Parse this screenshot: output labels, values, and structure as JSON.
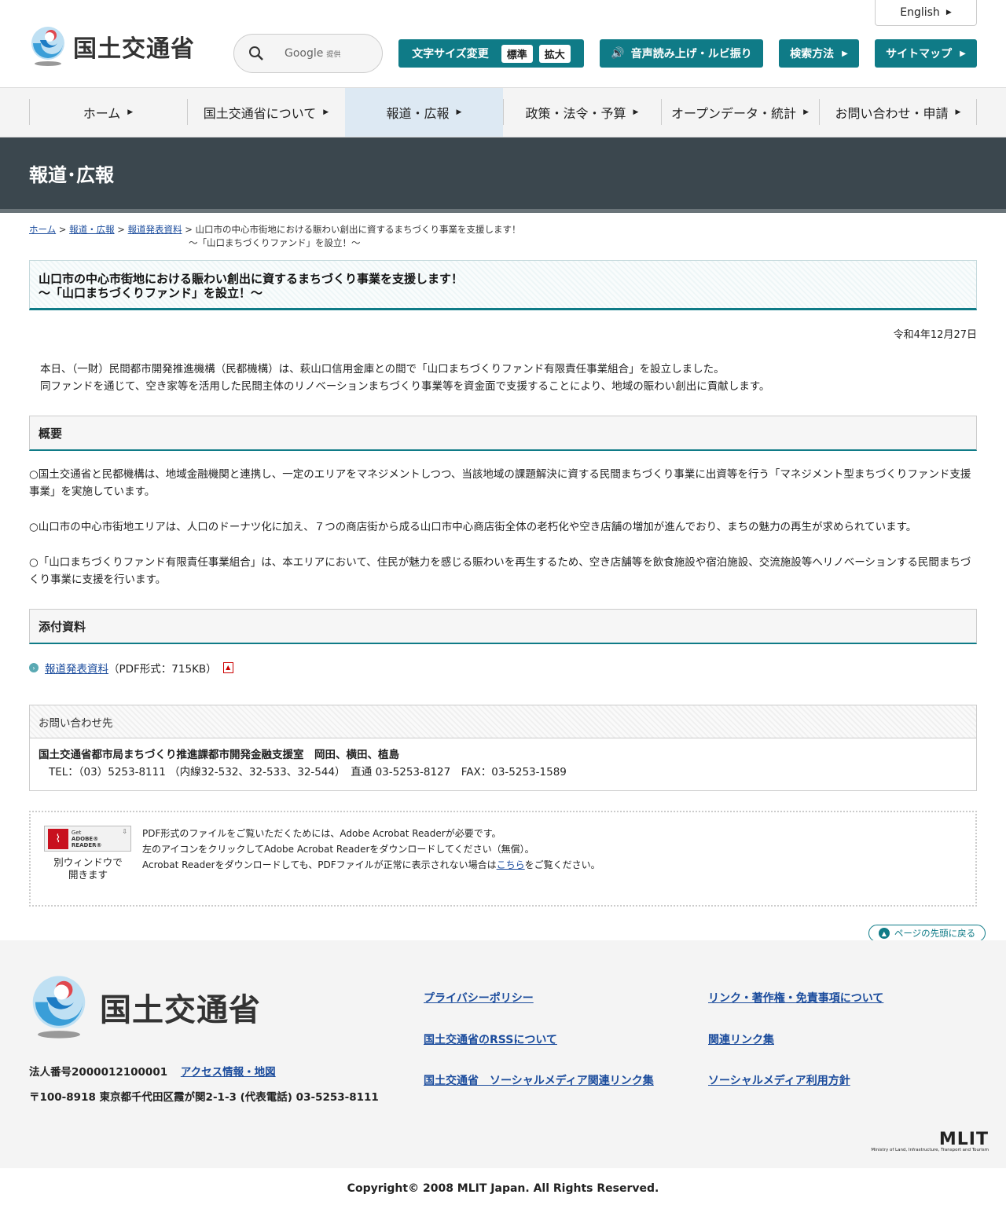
{
  "header": {
    "logo_text": "国土交通省",
    "english_label": "English",
    "search_placeholder": "Google",
    "search_provider_note": "提供",
    "font_size_label": "文字サイズ変更",
    "font_size_standard": "標準",
    "font_size_large": "拡大",
    "speech_label": "音声読み上げ・ルビ振り",
    "search_method_label": "検索方法",
    "sitemap_label": "サイトマップ"
  },
  "nav": {
    "items": [
      {
        "label": "ホーム"
      },
      {
        "label": "国土交通省について"
      },
      {
        "label": "報道・広報"
      },
      {
        "label": "政策・法令・予算"
      },
      {
        "label": "オープンデータ・統計"
      },
      {
        "label": "お問い合わせ・申請"
      }
    ]
  },
  "band_title": "報道･広報",
  "breadcrumb": {
    "home": "ホーム",
    "pr": "報道・広報",
    "releases": "報道発表資料",
    "current_line1": "山口市の中心市街地における賑わい創出に資するまちづくり事業を支援します！",
    "current_line2": "～「山口まちづくりファンド」を設立！～"
  },
  "article": {
    "title_line1": "山口市の中心市街地における賑わい創出に資するまちづくり事業を支援します！",
    "title_line2": "～「山口まちづくりファンド」を設立！～",
    "date": "令和4年12月27日",
    "lead_line1": "本日、（一財）民間都市開発推進機構（民都機構）は、萩山口信用金庫との間で「山口まちづくりファンド有限責任事業組合」を設立しました。",
    "lead_line2": "同ファンドを通じて、空き家等を活用した民間主体のリノベーションまちづくり事業等を資金面で支援することにより、地域の賑わい創出に貢献します。",
    "overview_heading": "概要",
    "overview_p1": "○国土交通省と民都機構は、地域金融機関と連携し、一定のエリアをマネジメントしつつ、当該地域の課題解決に資する民間まちづくり事業に出資等を行う「マネジメント型まちづくりファンド支援事業」を実施しています。",
    "overview_p2": "○山口市の中心市街地エリアは、人口のドーナツ化に加え、７つの商店街から成る山口市中心商店街全体の老朽化や空き店舗の増加が進んでおり、まちの魅力の再生が求められています。",
    "overview_p3": "○「山口まちづくりファンド有限責任事業組合」は、本エリアにおいて、住民が魅力を感じる賑わいを再生するため、空き店舗等を飲食施設や宿泊施設、交流施設等へリノベーションする民間まちづくり事業に支援を行います。",
    "attachments_heading": "添付資料",
    "attachment_link": "報道発表資料",
    "attachment_meta": "（PDF形式：715KB）"
  },
  "contact": {
    "heading": "お問い合わせ先",
    "name": "国土交通省都市局まちづくり推進課都市開発金融支援室　岡田、横田、植島",
    "tel": "TEL：（03）5253-8111 （内線32-532、32-533、32-544）　直通 03-5253-8127　FAX：03-5253-1589"
  },
  "reader": {
    "badge_line1": "Get",
    "badge_line2": "ADOBE® READER®",
    "new_window_line1": "別ウィンドウで",
    "new_window_line2": "開きます",
    "msg_line1": "PDF形式のファイルをご覧いただくためには、Adobe Acrobat Readerが必要です。",
    "msg_line2": "左のアイコンをクリックしてAdobe Acrobat Readerをダウンロードしてください（無償）。",
    "msg_line3_before": "Acrobat Readerをダウンロードしても、PDFファイルが正常に表示されない場合は",
    "msg_line3_link": "こちら",
    "msg_line3_after": "をご覧ください。"
  },
  "back_to_top": "ページの先頭に戻る",
  "footer": {
    "logo_text": "国土交通省",
    "corp_number": "法人番号2000012100001",
    "access_link": "アクセス情報・地図",
    "address": "〒100-8918 東京都千代田区霞が関2-1-3 (代表電話) 03-5253-8111",
    "links": [
      "プライバシーポリシー",
      "リンク・著作権・免責事項について",
      "国土交通省のRSSについて",
      "関連リンク集",
      "国土交通省　ソーシャルメディア関連リンク集",
      "ソーシャルメディア利用方針"
    ],
    "mlit_mark": "MLIT",
    "mlit_sub": "Ministry of Land, Infrastructure, Transport and Tourism",
    "copyright": "Copyright© 2008 MLIT Japan. All Rights Reserved."
  },
  "colors": {
    "accent": "#0f7b87",
    "band": "#3b474e",
    "link": "#1a4b9c"
  }
}
